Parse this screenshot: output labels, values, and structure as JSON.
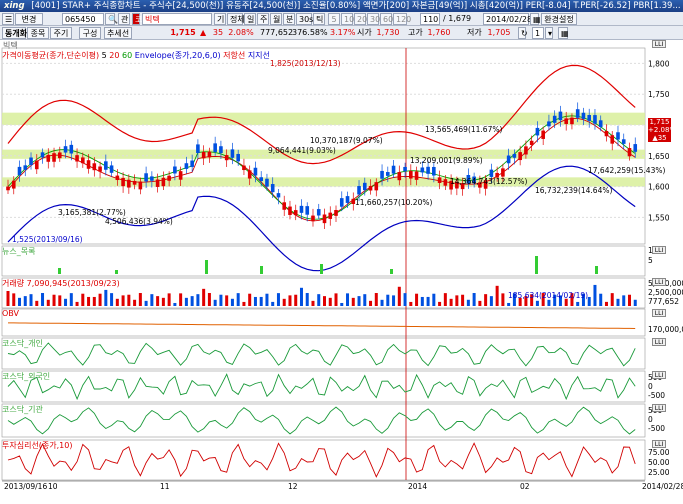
{
  "titlebar": {
    "logo": "xing",
    "text": "[4001] STAR+ 주식종합차트 - 주식수[24,500(천)] 유동주[24,500(천)] 소진율[0.80%] 액면가[200] 자본금[49(억)] 시총[420(억)] PER[-8.04] T.PER[-26.52] PBR[1.39..."
  },
  "toolbar": {
    "mode_dropdown": "변경",
    "stock_code": "065450",
    "chart_icon_label": "관",
    "stock_name": "빅텍",
    "periods": [
      "기",
      "정체",
      "일",
      "주",
      "월",
      "분",
      "30s",
      "틱"
    ],
    "numbers": [
      "5",
      "10",
      "20",
      "30",
      "60",
      "120"
    ],
    "count_value": "110",
    "count_total": "/ 1,679",
    "date_value": "2014/02/28",
    "settings_label": "환경설정",
    "one_label": "1"
  },
  "quote": {
    "tab1": "동개화",
    "tab2": "종목",
    "tab3": "주기",
    "tab4": "구성",
    "tab5": "추세선",
    "price": "1,715",
    "change_arrow": "▲",
    "change": "35",
    "change_pct": "2.08%",
    "volume": "777,652",
    "amount": "376.58%",
    "rate": "3.17%",
    "open_label": "시가",
    "open": "1,730",
    "high_label": "고가",
    "high": "1,760",
    "low_label": "저가",
    "low": "1,705"
  },
  "chart": {
    "stock_label": "빅텍",
    "legend_text": "가격이동평균(종가,단순이평)",
    "ma_values": [
      "5",
      "20",
      "60"
    ],
    "envelope_label": "Envelope(종가,20,6,0)",
    "resist_label": "저항선",
    "support_label": "지지선",
    "y_ticks": [
      "1,800",
      "1,750",
      "1,700",
      "1,650",
      "1,600",
      "1,550"
    ],
    "price_tag": [
      "1,715",
      "+2.08%",
      "▲35"
    ],
    "annotations": [
      "1,825(2013/12/13)",
      "10,370,187(9.07%)",
      "9,064,441(9.03%)",
      "13,565,469(11.67%)",
      "13,209,001(9.89%)",
      "14,364,743(12.57%)",
      "3,165,381(2.77%)",
      "4,506,436(3.94%)",
      "11,660,257(10.20%)",
      "16,732,239(14.64%)",
      "17,642,259(15.43%)",
      "1,525(2013/09/16)"
    ],
    "news_label": "뉴스_목록",
    "volume_label": "거래량",
    "volume_max": "7,090,945(2013/09/23)",
    "volume_note": "185,634(2014/02/19)",
    "volume_ticks": [
      "5,000,000",
      "2,500,000",
      "777,652"
    ],
    "obv_label": "OBV",
    "obv_ticks": [
      "170,000,000"
    ],
    "ind1_label": "코스닥_개인",
    "ind2_label": "코스닥_외국인",
    "ind2_ticks": [
      "500",
      "0",
      "-500"
    ],
    "ind3_label": "코스닥_기관",
    "ind3_ticks": [
      "500",
      "0",
      "-500"
    ],
    "ind4_label": "투자심리선(종가,10)",
    "ind4_ticks": [
      "75.00",
      "50.00",
      "25.00"
    ],
    "x_ticks": [
      "2013/09/16",
      "10",
      "11",
      "12",
      "2014",
      "02",
      "2014/02/28"
    ],
    "news_ticks": [
      "10",
      "5"
    ]
  },
  "colors": {
    "up": "#e00000",
    "down": "#0050e0",
    "env_upper": "#e00000",
    "env_lower": "#0000c0",
    "zone_fill": "#d8ef9a",
    "ma20": "#d00000",
    "ma60": "#00a000"
  },
  "menu_btn": "LLI"
}
